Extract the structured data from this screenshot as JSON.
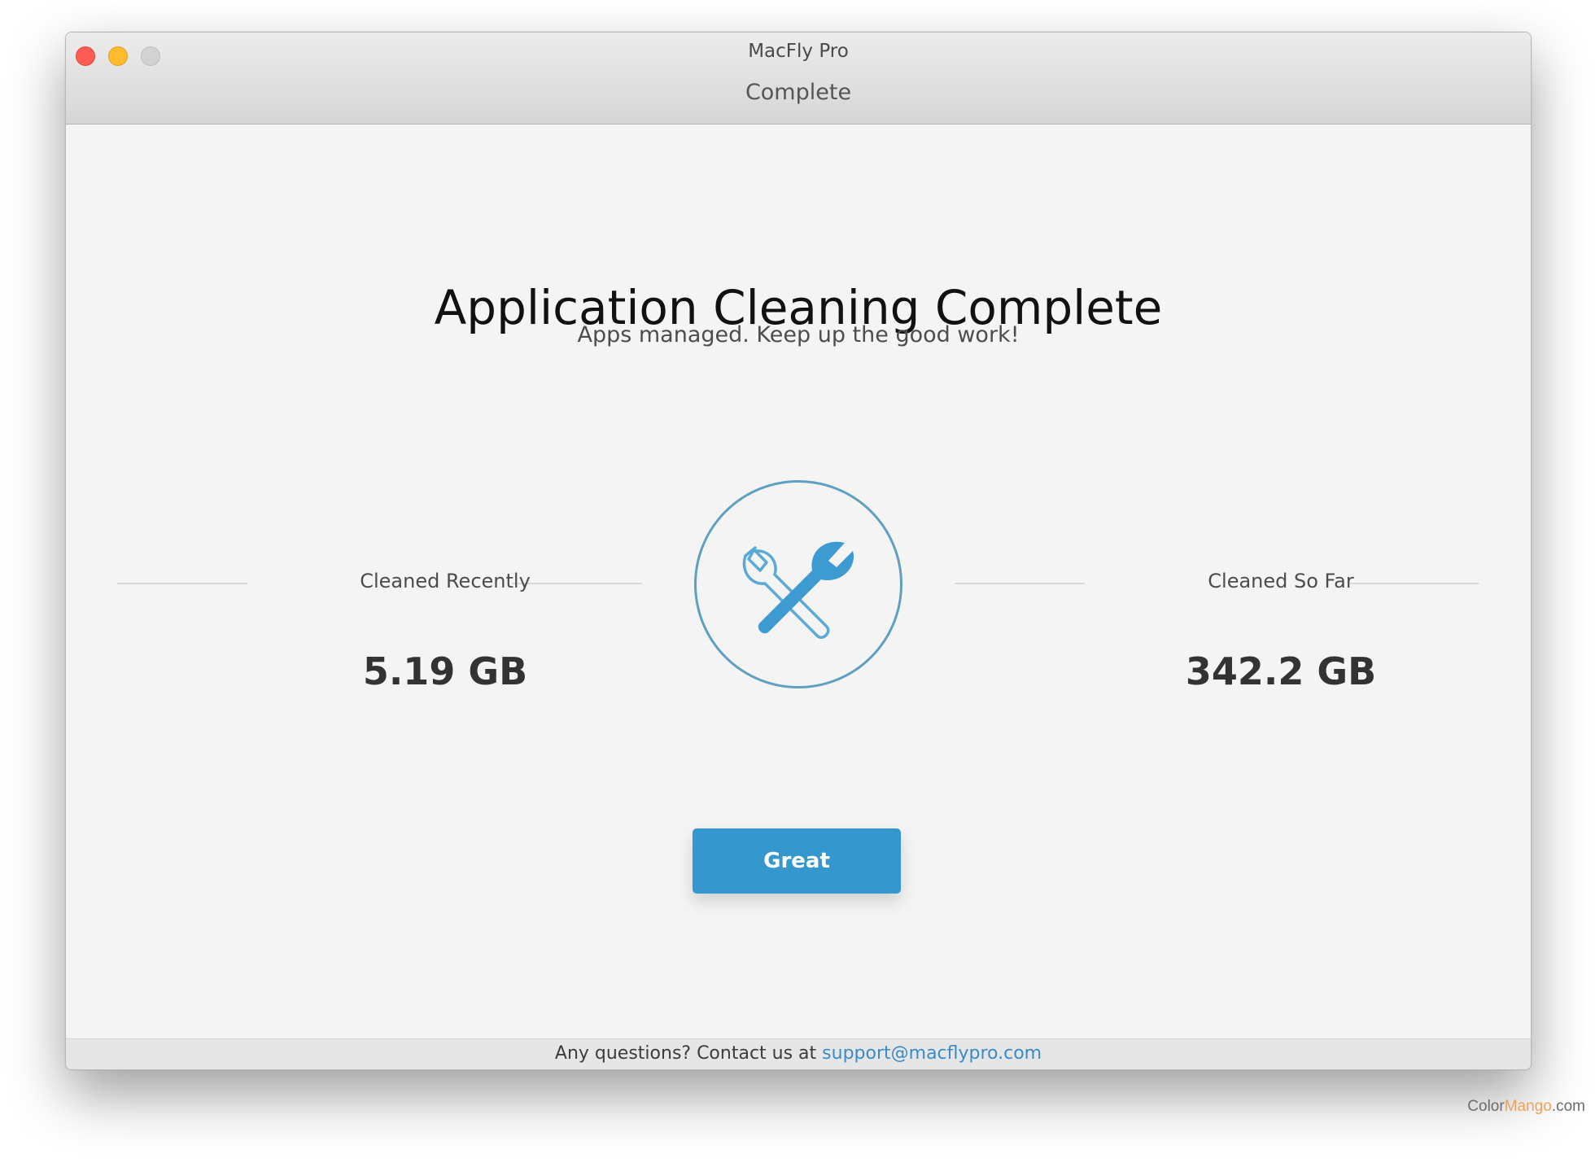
{
  "window": {
    "app_title": "MacFly Pro",
    "screen_title": "Complete"
  },
  "main": {
    "heading": "Application Cleaning Complete",
    "subheading": "Apps managed. Keep up the good work!",
    "tool_icon": "wrench-screwdriver-icon"
  },
  "stats": {
    "recent": {
      "label": "Cleaned Recently",
      "value": "5.19 GB"
    },
    "total": {
      "label": "Cleaned So Far",
      "value": "342.2 GB"
    }
  },
  "actions": {
    "great_label": "Great"
  },
  "footer": {
    "text": "Any questions? Contact us at",
    "email": "support@macflypro.com"
  },
  "watermark": {
    "part1": "Color",
    "part2": "Mango",
    "part3": ".com"
  },
  "colors": {
    "accent": "#3498ce",
    "link": "#3a8bc9",
    "icon_stroke": "#5f9fc2"
  }
}
